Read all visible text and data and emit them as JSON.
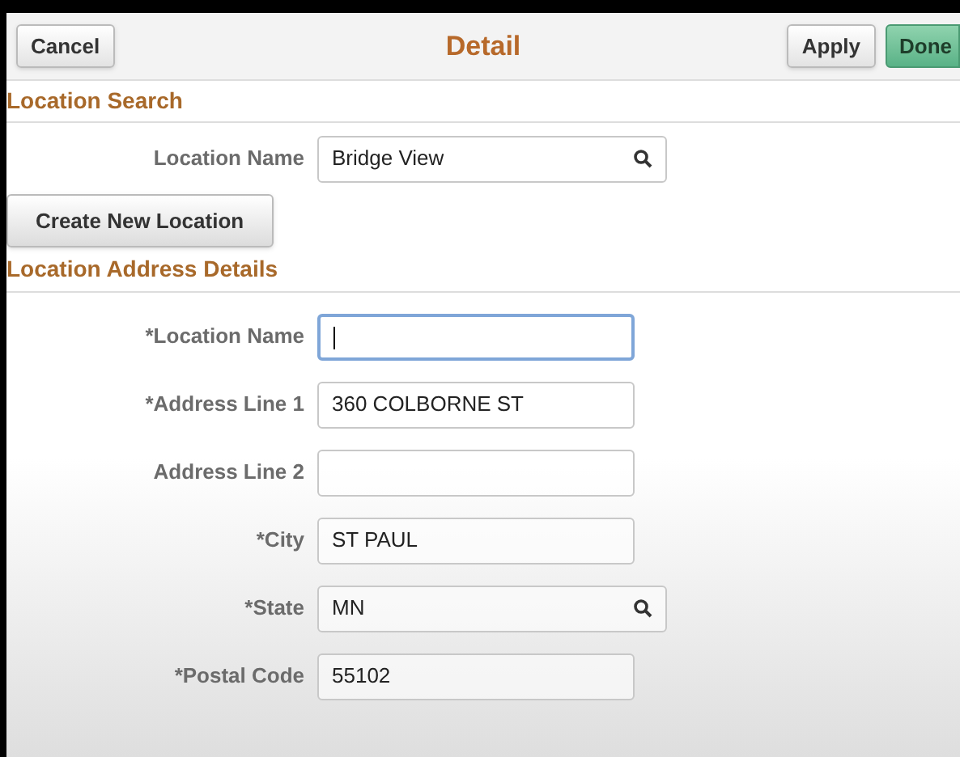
{
  "header": {
    "cancel": "Cancel",
    "title": "Detail",
    "apply": "Apply",
    "done": "Done"
  },
  "location_search": {
    "heading": "Location Search",
    "field": {
      "label": "Location Name",
      "value": "Bridge View",
      "kind": "lookup",
      "focused": false
    }
  },
  "create_button": "Create New Location",
  "address_details": {
    "heading": "Location Address Details",
    "fields": [
      {
        "label": "*Location Name",
        "kind": "text",
        "focused": true
      },
      {
        "label": "*Address Line 1",
        "value": "360 COLBORNE ST",
        "kind": "text",
        "focused": false
      },
      {
        "label": "Address Line 2",
        "kind": "text",
        "focused": false
      },
      {
        "label": "*City",
        "value": "ST PAUL",
        "kind": "text",
        "focused": false
      },
      {
        "label": "*State",
        "value": "MN",
        "kind": "lookup",
        "focused": false
      },
      {
        "label": "*Postal Code",
        "value": "55102",
        "kind": "text",
        "focused": false
      }
    ]
  }
}
